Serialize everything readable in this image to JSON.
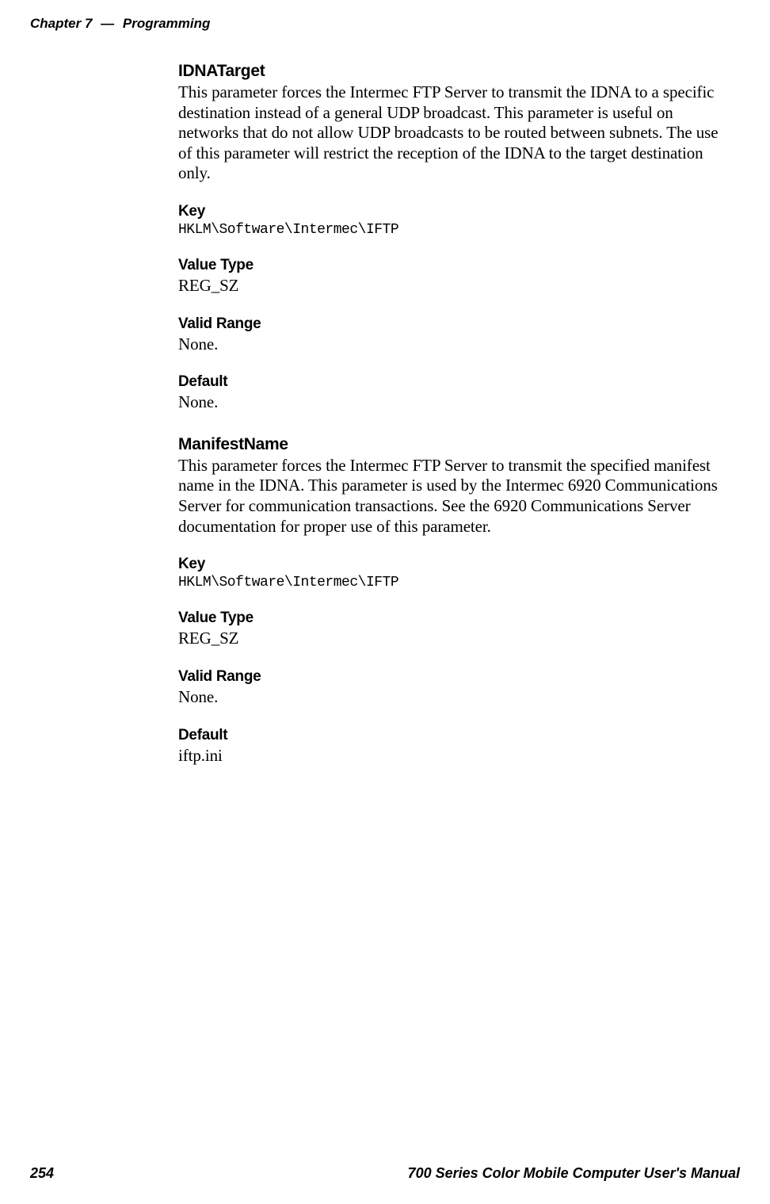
{
  "header": {
    "chapter": "Chapter 7",
    "separator": "—",
    "title": "Programming"
  },
  "sections": {
    "idnatarget": {
      "heading": "IDNATarget",
      "body": "This parameter forces the Intermec FTP Server to transmit the IDNA to a specific destination instead of a general UDP broadcast. This parameter is useful on networks that do not allow UDP broadcasts to be routed between subnets. The use of this parameter will restrict the reception of the IDNA to the target destination only.",
      "key_label": "Key",
      "key_value": "HKLM\\Software\\Intermec\\IFTP",
      "valuetype_label": "Value Type",
      "valuetype_value": "REG_SZ",
      "validrange_label": "Valid Range",
      "validrange_value": "None.",
      "default_label": "Default",
      "default_value": "None."
    },
    "manifestname": {
      "heading": "ManifestName",
      "body": "This parameter forces the Intermec FTP Server to transmit the specified manifest name in the IDNA. This parameter is used by the Intermec 6920 Communications Server for communication transactions. See the 6920 Communications Server documentation for proper use of this parameter.",
      "key_label": "Key",
      "key_value": "HKLM\\Software\\Intermec\\IFTP",
      "valuetype_label": "Value Type",
      "valuetype_value": "REG_SZ",
      "validrange_label": "Valid Range",
      "validrange_value": "None.",
      "default_label": "Default",
      "default_value": "iftp.ini"
    }
  },
  "footer": {
    "page": "254",
    "title": "700 Series Color Mobile Computer User's Manual"
  }
}
